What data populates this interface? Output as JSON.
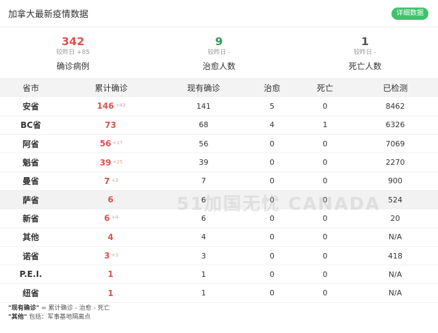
{
  "header": {
    "title": "加拿大最新疫情数据",
    "detail_button": "详细数据"
  },
  "summary": [
    {
      "num": "342",
      "cmp": "较昨日 +85",
      "label": "确诊病例",
      "color": "red"
    },
    {
      "num": "9",
      "cmp": "较昨日 -",
      "label": "治愈人数",
      "color": "green"
    },
    {
      "num": "1",
      "cmp": "较昨日 -",
      "label": "死亡人数",
      "color": "gray"
    }
  ],
  "table": {
    "headers": [
      "省市",
      "累计确诊",
      "现有确诊",
      "治愈",
      "死亡",
      "已检测"
    ],
    "rows": [
      {
        "prov": "安省",
        "confirmed": "146",
        "delta": "+43",
        "current": "141",
        "cured": "5",
        "dead": "0",
        "tested": "8462"
      },
      {
        "prov": "BC省",
        "confirmed": "73",
        "delta": "",
        "current": "68",
        "cured": "4",
        "dead": "1",
        "tested": "6326"
      },
      {
        "prov": "阿省",
        "confirmed": "56",
        "delta": "+17",
        "current": "56",
        "cured": "0",
        "dead": "0",
        "tested": "7069"
      },
      {
        "prov": "魁省",
        "confirmed": "39",
        "delta": "+25",
        "current": "39",
        "cured": "0",
        "dead": "0",
        "tested": "2270"
      },
      {
        "prov": "曼省",
        "confirmed": "7",
        "delta": "+3",
        "current": "7",
        "cured": "0",
        "dead": "0",
        "tested": "900"
      },
      {
        "prov": "萨省",
        "confirmed": "6",
        "delta": "",
        "current": "6",
        "cured": "0",
        "dead": "0",
        "tested": "524"
      },
      {
        "prov": "新省",
        "confirmed": "6",
        "delta": "+4",
        "current": "6",
        "cured": "0",
        "dead": "0",
        "tested": "20"
      },
      {
        "prov": "其他",
        "confirmed": "4",
        "delta": "",
        "current": "4",
        "cured": "0",
        "dead": "0",
        "tested": "N/A"
      },
      {
        "prov": "诺省",
        "confirmed": "3",
        "delta": "+3",
        "current": "3",
        "cured": "0",
        "dead": "0",
        "tested": "418"
      },
      {
        "prov": "P.E.I.",
        "confirmed": "1",
        "delta": "",
        "current": "1",
        "cured": "0",
        "dead": "0",
        "tested": "N/A"
      },
      {
        "prov": "纽省",
        "confirmed": "1",
        "delta": "",
        "current": "1",
        "cured": "0",
        "dead": "0",
        "tested": "N/A"
      }
    ]
  },
  "watermark": "51加国无忧 CANADA",
  "notes": {
    "line1_key": "\"现有确诊\"",
    "line1_val": " = 累计确诊 - 治愈 - 死亡",
    "line2_key": "\"其他\"",
    "line2_val": " 包括：军事基地隔离点"
  }
}
